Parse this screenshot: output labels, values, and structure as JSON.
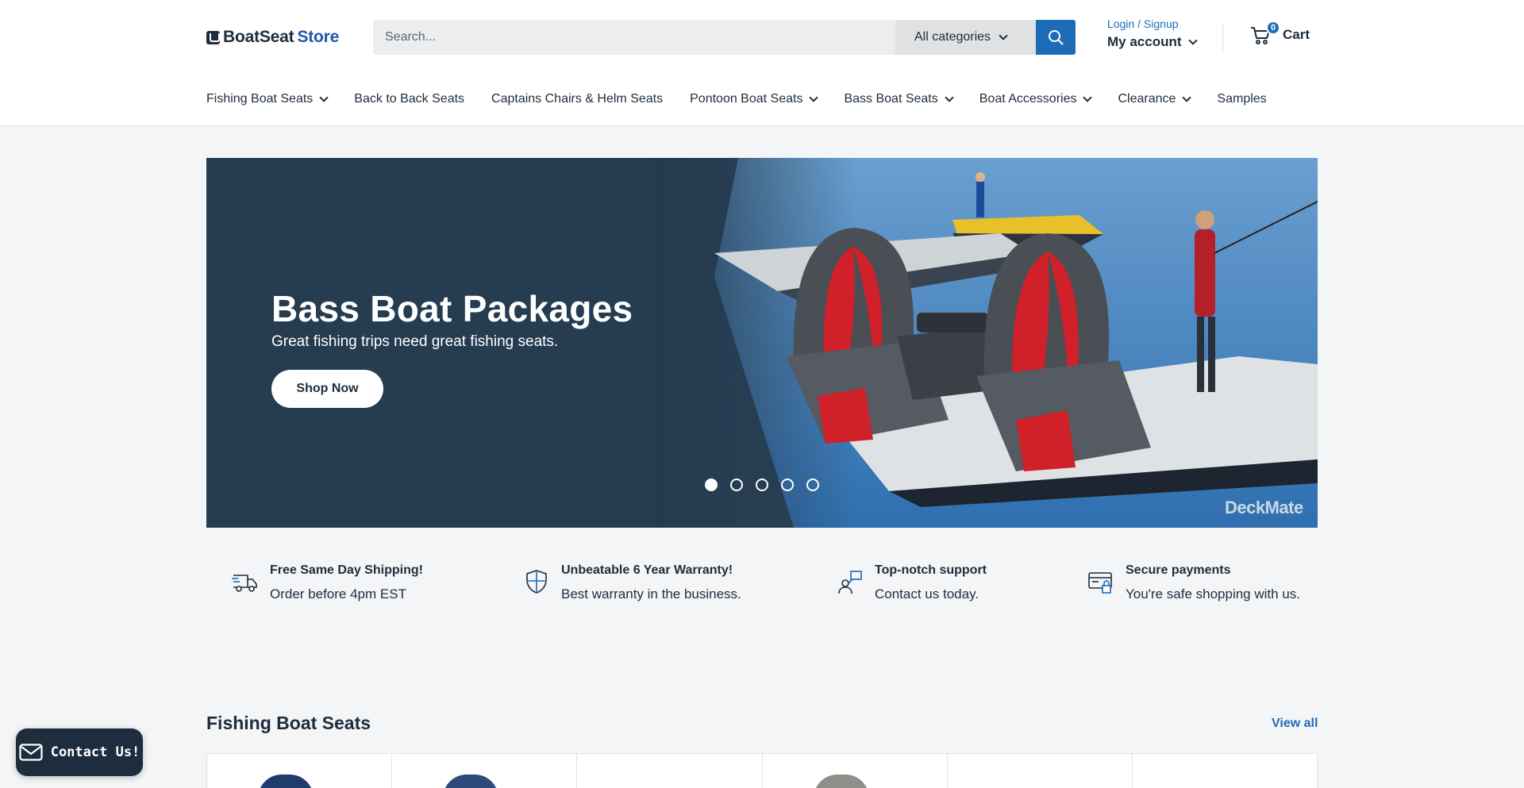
{
  "header": {
    "logo": {
      "part1": "BoatSeat",
      "part2": "Store"
    },
    "search": {
      "placeholder": "Search...",
      "category": "All categories"
    },
    "account": {
      "login": "Login / Signup",
      "my_account": "My account"
    },
    "cart": {
      "count": "0",
      "label": "Cart"
    }
  },
  "nav": {
    "items": [
      {
        "label": "Fishing Boat Seats",
        "dropdown": true
      },
      {
        "label": "Back to Back Seats",
        "dropdown": false
      },
      {
        "label": "Captains Chairs & Helm Seats",
        "dropdown": false
      },
      {
        "label": "Pontoon Boat Seats",
        "dropdown": true
      },
      {
        "label": "Bass Boat Seats",
        "dropdown": true
      },
      {
        "label": "Boat Accessories",
        "dropdown": true
      },
      {
        "label": "Clearance",
        "dropdown": true
      },
      {
        "label": "Samples",
        "dropdown": false
      }
    ]
  },
  "hero": {
    "title": "Bass Boat Packages",
    "subtitle": "Great fishing trips need great fishing seats.",
    "button": "Shop Now",
    "brand": "DeckMate",
    "slide_count": 5,
    "active_slide": 1
  },
  "features": [
    {
      "icon": "truck-icon",
      "title": "Free Same Day Shipping!",
      "text": "Order before 4pm EST"
    },
    {
      "icon": "shield-icon",
      "title": "Unbeatable 6 Year Warranty!",
      "text": "Best warranty in the business."
    },
    {
      "icon": "support-icon",
      "title": "Top-notch support",
      "text": "Contact us today."
    },
    {
      "icon": "credit-card-lock-icon",
      "title": "Secure payments",
      "text": "You're safe shopping with us."
    }
  ],
  "section": {
    "title": "Fishing Boat Seats",
    "view_all": "View all"
  },
  "contact_widget": {
    "label": "Contact Us!",
    "icon": "envelope-icon"
  },
  "colors": {
    "accent": "#1e6bb8",
    "text": "#1e2d3d",
    "seat_red": "#d0202a",
    "seat_gray": "#4a4e55"
  }
}
